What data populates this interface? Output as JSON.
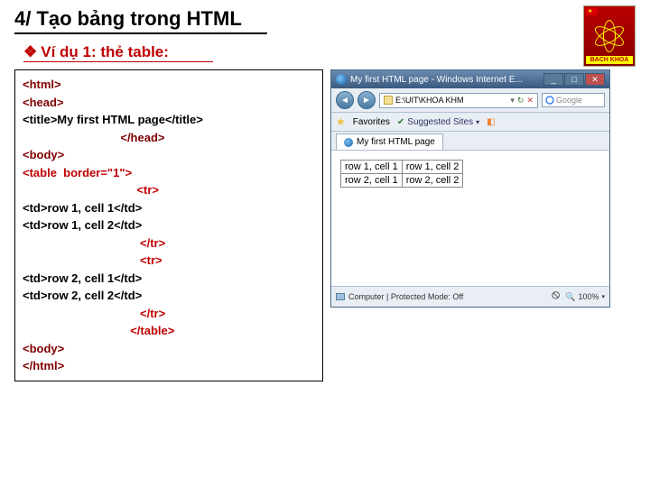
{
  "slide": {
    "title": "4/ Tạo bảng trong HTML",
    "subtitle_bullet": "❖",
    "subtitle": "Ví dụ 1: thẻ table:"
  },
  "code": {
    "lines": [
      {
        "cls": "maroon",
        "txt": "<html>"
      },
      {
        "cls": "maroon",
        "txt": "<head>"
      },
      {
        "cls": "black",
        "txt": "<title>My first HTML page</title>"
      },
      {
        "cls": "maroon",
        "txt": "                              </head>"
      },
      {
        "cls": "maroon",
        "txt": "<body>"
      },
      {
        "cls": "red",
        "txt": "<table  border=\"1\">"
      },
      {
        "cls": "red",
        "txt": "                                   <tr>"
      },
      {
        "cls": "black",
        "txt": "<td>row 1, cell 1</td>"
      },
      {
        "cls": "black",
        "txt": "<td>row 1, cell 2</td>"
      },
      {
        "cls": "red",
        "txt": "                                    </tr>"
      },
      {
        "cls": "red",
        "txt": "                                    <tr>"
      },
      {
        "cls": "black",
        "txt": "<td>row 2, cell 1</td>"
      },
      {
        "cls": "black",
        "txt": "<td>row 2, cell 2</td>"
      },
      {
        "cls": "red",
        "txt": "                                    </tr>"
      },
      {
        "cls": "red",
        "txt": "                                 </table>"
      },
      {
        "cls": "maroon",
        "txt": "<body>"
      },
      {
        "cls": "maroon",
        "txt": "</html>"
      }
    ]
  },
  "browser": {
    "title": "My first HTML page - Windows Internet E...",
    "address": "E:\\UIT\\KHOA KHM",
    "search_placeholder": "Google",
    "favorites": "Favorites",
    "suggested": "Suggested Sites",
    "tab": "My first HTML page",
    "status_left": "Computer | Protected Mode: Off",
    "zoom": "100%",
    "table": {
      "rows": [
        [
          "row 1, cell 1",
          "row 1, cell 2"
        ],
        [
          "row 2, cell 1",
          "row 2, cell 2"
        ]
      ]
    }
  },
  "logo": {
    "text": "BACH KHOA"
  }
}
